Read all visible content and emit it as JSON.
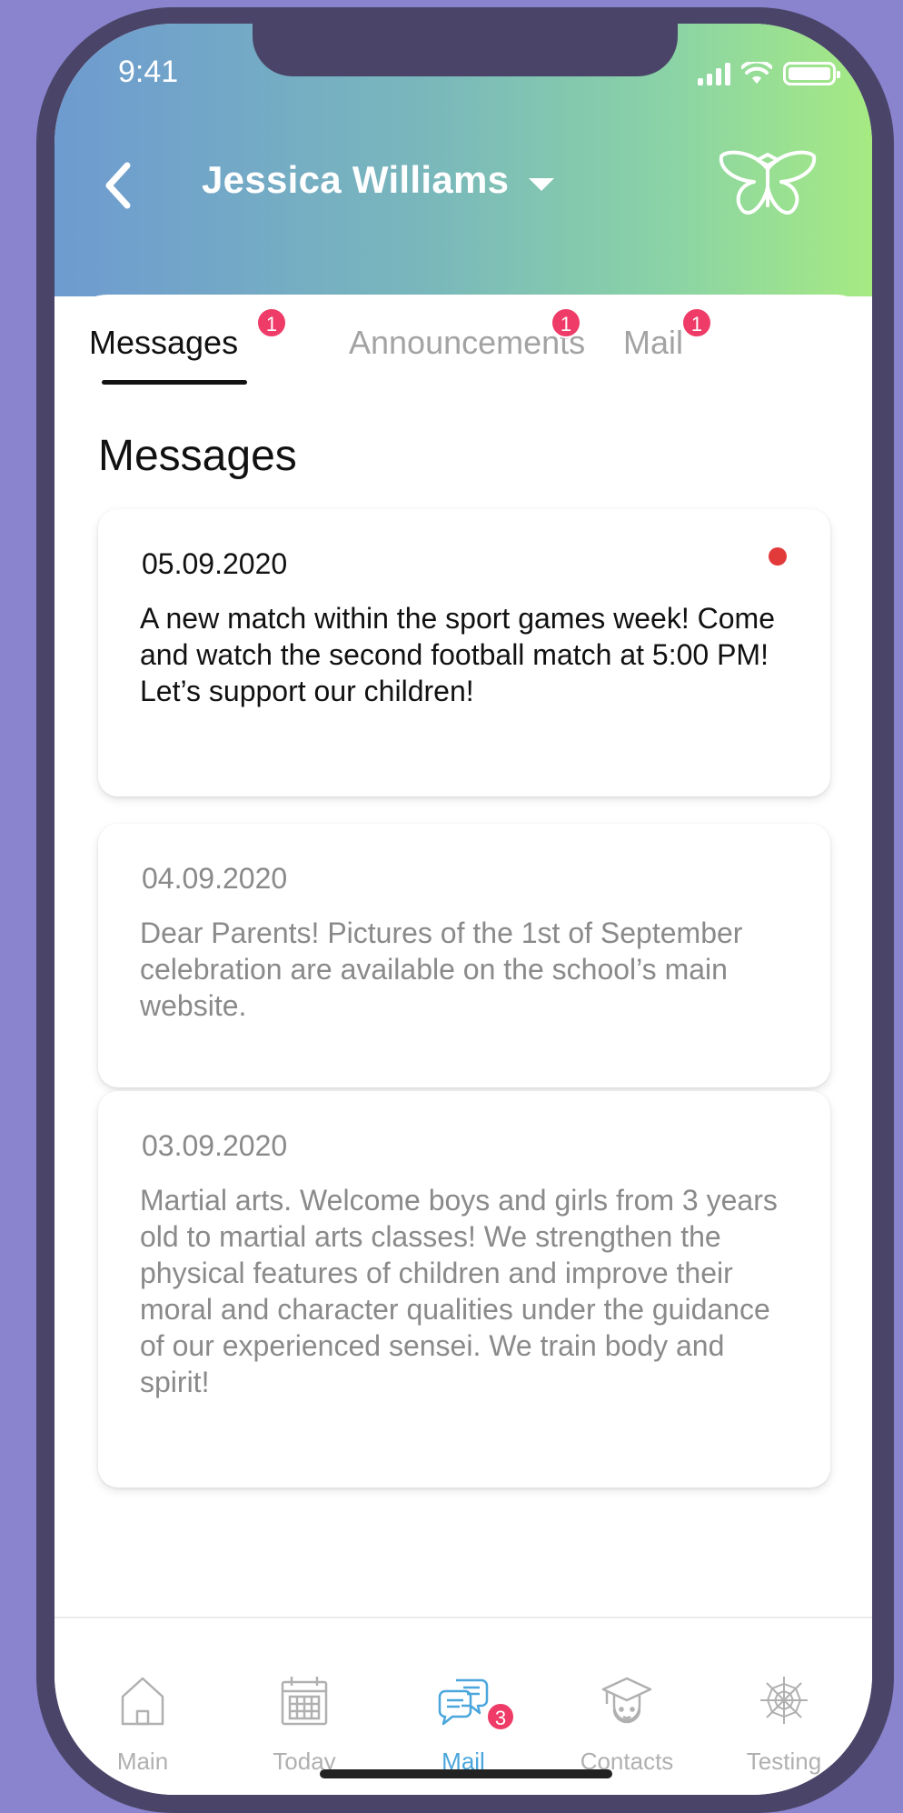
{
  "status": {
    "time": "9:41"
  },
  "header": {
    "user_name": "Jessica Williams"
  },
  "tabs": [
    {
      "label": "Messages",
      "badge": "1",
      "active": true
    },
    {
      "label": "Announcements",
      "badge": "1",
      "active": false
    },
    {
      "label": "Mail",
      "badge": "1",
      "active": false
    }
  ],
  "section_title": "Messages",
  "messages": [
    {
      "date": "05.09.2020",
      "text": "A new match within the sport games week! Come and watch the second football match at 5:00 PM! Let’s support our children!",
      "unread": true
    },
    {
      "date": "04.09.2020",
      "text": "Dear Parents! Pictures of the 1st of September celebration are available on the school’s main website.",
      "unread": false
    },
    {
      "date": "03.09.2020",
      "text": "Martial arts. Welcome boys and girls from 3 years old to martial arts classes! We strengthen the physical features of children and improve their moral and character qualities under the guidance of our experienced sensei. We train body and spirit!",
      "unread": false
    }
  ],
  "bottom_nav": [
    {
      "label": "Main",
      "icon": "home-icon"
    },
    {
      "label": "Today",
      "icon": "calendar-icon"
    },
    {
      "label": "Mail",
      "icon": "chat-bubbles-icon",
      "badge": "3",
      "active": true
    },
    {
      "label": "Contacts",
      "icon": "graduate-icon"
    },
    {
      "label": "Testing",
      "icon": "web-icon"
    }
  ],
  "colors": {
    "gradient_start": "#6e9bd0",
    "gradient_end": "#a6ea82",
    "badge": "#ee3b67",
    "active_nav": "#4aa6dc",
    "unread_dot": "#e23a3a"
  }
}
